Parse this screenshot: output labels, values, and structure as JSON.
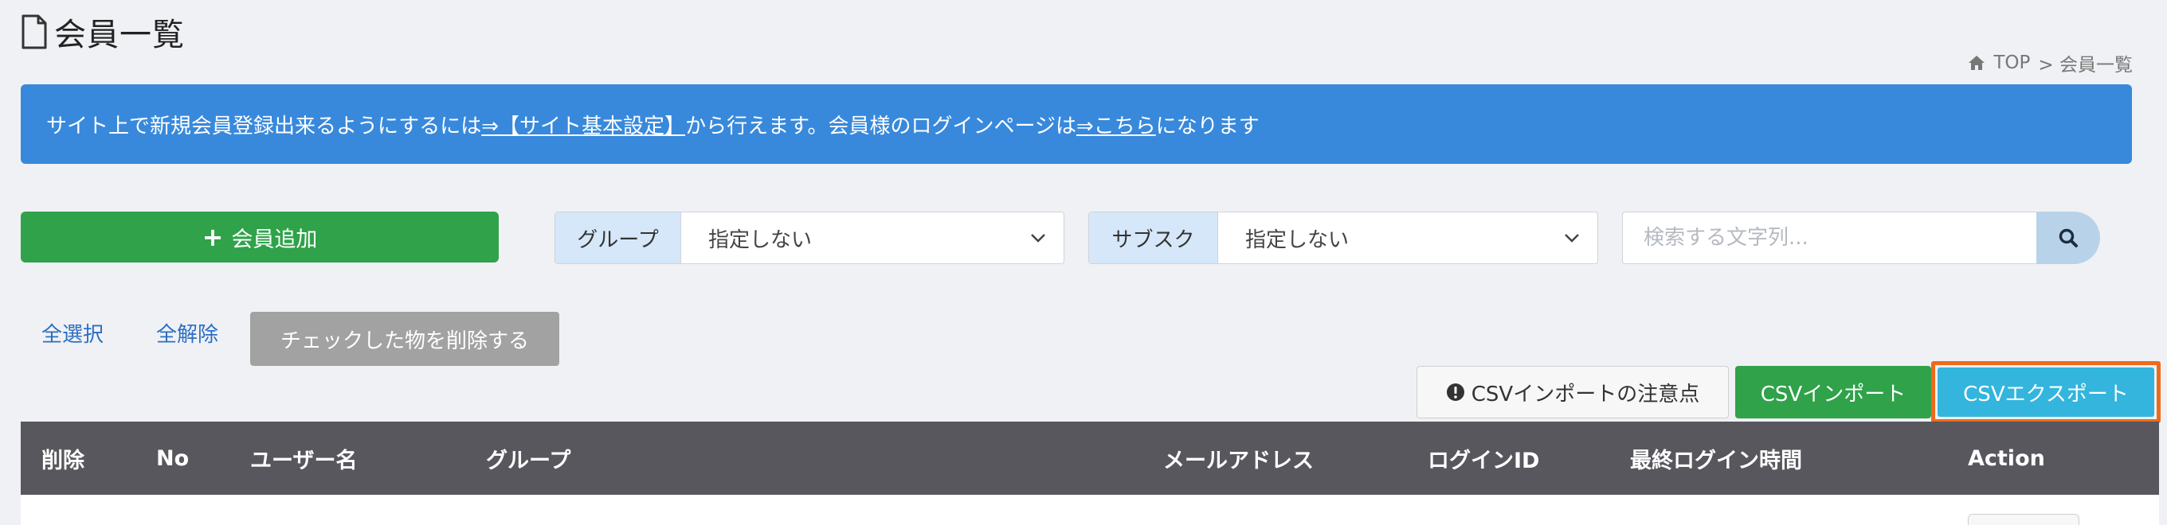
{
  "page": {
    "title": "会員一覧",
    "title_icon": "document-icon"
  },
  "breadcrumb": {
    "home_icon": "home-icon",
    "items": [
      "TOP",
      "> 会員一覧"
    ]
  },
  "banner": {
    "text_before": "サイト上で新規会員登録出来るようにするには",
    "link1": "⇒【サイト基本設定】",
    "text_middle": "から行えます。会員様のログインページは",
    "link2": "⇒こちら",
    "text_after": "になります",
    "color": "#3889dc"
  },
  "toolbar": {
    "add_member_label": "会員追加",
    "add_icon": "plus-icon",
    "group_filter": {
      "label": "グループ",
      "selected": "指定しない"
    },
    "subscription_filter": {
      "label": "サブスク",
      "selected": "指定しない"
    },
    "search": {
      "placeholder": "検索する文字列...",
      "icon": "search-icon"
    }
  },
  "selection": {
    "select_all": "全選択",
    "deselect_all": "全解除",
    "delete_checked": "チェックした物を削除する"
  },
  "csv": {
    "note_label": "CSVインポートの注意点",
    "note_icon": "exclamation-circle-icon",
    "import_label": "CSVインポート",
    "export_label": "CSVエクスポート"
  },
  "table": {
    "columns": [
      "削除",
      "No",
      "ユーザー名",
      "グループ",
      "メールアドレス",
      "ログインID",
      "最終ログイン時間",
      "Action"
    ]
  },
  "colors": {
    "success": "#2fa24a",
    "info": "#33b5dd",
    "highlight": "#ee6a1c",
    "table_header": "#58575d"
  }
}
